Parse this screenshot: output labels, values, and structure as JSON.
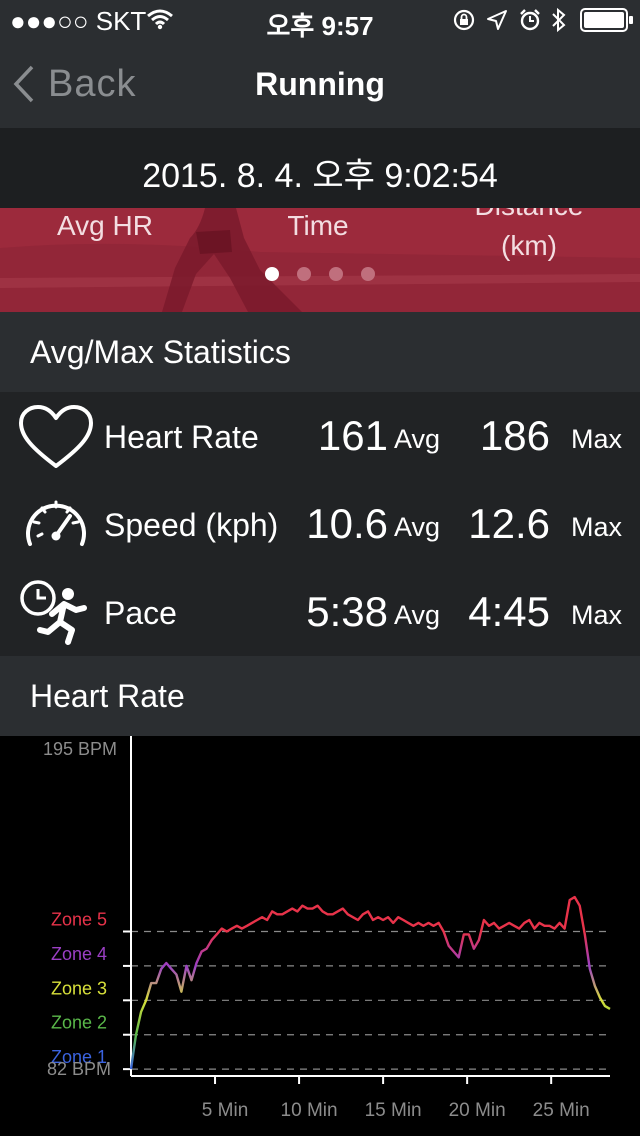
{
  "status_bar": {
    "carrier": "●●●○○ SKT",
    "time": "오후 9:57"
  },
  "nav": {
    "back_label": "Back",
    "title": "Running"
  },
  "date_label": "2015. 8. 4. 오후 9:02:54",
  "banner": {
    "labels": [
      "Avg HR",
      "Time",
      "Distance",
      "(km)"
    ],
    "page_count": 4,
    "active_page": 0
  },
  "avgmax": {
    "header": "Avg/Max Statistics",
    "rows": [
      {
        "label": "Heart Rate",
        "avg": "161",
        "avg_unit": "Avg",
        "max": "186",
        "max_unit": "Max",
        "icon": "heart-icon"
      },
      {
        "label": "Speed (kph)",
        "avg": "10.6",
        "avg_unit": "Avg",
        "max": "12.6",
        "max_unit": "Max",
        "icon": "speedometer-icon"
      },
      {
        "label": "Pace",
        "avg": "5:38",
        "avg_unit": "Avg",
        "max": "4:45",
        "max_unit": "Max",
        "icon": "runner-clock-icon"
      }
    ]
  },
  "heart_rate_header": "Heart Rate",
  "chart_data": {
    "type": "line",
    "xlabel": "",
    "ylabel": "",
    "x_unit": "min",
    "xlim": [
      0,
      28.5
    ],
    "ylim": [
      82,
      195
    ],
    "x_ticks": [
      5,
      10,
      15,
      20,
      25
    ],
    "x_tick_labels": [
      "5 Min",
      "10 Min",
      "15 Min",
      "20 Min",
      "25 Min"
    ],
    "y_top_label": "195 BPM",
    "y_bottom_label": "82 BPM",
    "zones": [
      {
        "name": "Zone 1",
        "value": 83,
        "color": "#3b63e0"
      },
      {
        "name": "Zone 2",
        "value": 95,
        "color": "#5ab84a"
      },
      {
        "name": "Zone 3",
        "value": 107,
        "color": "#d8e03a"
      },
      {
        "name": "Zone 4",
        "value": 119,
        "color": "#9b3fc4"
      },
      {
        "name": "Zone 5",
        "value": 131,
        "color": "#e8334a"
      }
    ],
    "grid": true,
    "series": [
      {
        "x": [
          0,
          0.3,
          0.6,
          0.9,
          1.2,
          1.5,
          1.8,
          2.1,
          2.4,
          2.7,
          3.0,
          3.3,
          3.6,
          3.9,
          4.2,
          4.5,
          4.8,
          5.1,
          5.4,
          5.7,
          6.0,
          6.3,
          6.6,
          6.9,
          7.2,
          7.5,
          7.8,
          8.1,
          8.4,
          8.7,
          9.0,
          9.3,
          9.6,
          9.9,
          10.2,
          10.5,
          10.8,
          11.1,
          11.4,
          11.7,
          12.0,
          12.3,
          12.6,
          12.9,
          13.2,
          13.5,
          13.8,
          14.1,
          14.4,
          14.7,
          15.0,
          15.3,
          15.6,
          15.9,
          16.2,
          16.5,
          16.8,
          17.1,
          17.4,
          17.7,
          18.0,
          18.3,
          18.6,
          18.9,
          19.2,
          19.5,
          19.8,
          20.1,
          20.4,
          20.7,
          21.0,
          21.3,
          21.6,
          21.9,
          22.2,
          22.5,
          22.8,
          23.1,
          23.4,
          23.7,
          24.0,
          24.3,
          24.6,
          24.9,
          25.2,
          25.5,
          25.8,
          26.1,
          26.4,
          26.7,
          27.0,
          27.3,
          27.6,
          27.9,
          28.2,
          28.5
        ],
        "y": [
          83,
          95,
          103,
          107,
          113,
          113,
          118,
          120,
          118,
          116,
          110,
          119,
          114,
          120,
          124,
          125,
          128,
          130,
          132,
          131,
          132,
          133,
          132,
          133,
          134,
          135,
          136,
          135,
          138,
          137,
          137,
          138,
          139,
          138,
          140,
          139,
          139,
          140,
          138,
          137,
          137,
          138,
          139,
          137,
          136,
          135,
          137,
          138,
          135,
          136,
          135,
          136,
          134,
          136,
          135,
          134,
          133,
          134,
          133,
          134,
          133,
          134,
          131,
          126,
          124,
          122,
          130,
          130,
          125,
          128,
          135,
          133,
          134,
          132,
          133,
          134,
          133,
          132,
          134,
          135,
          132,
          134,
          133,
          133,
          132,
          134,
          132,
          142,
          143,
          140,
          130,
          118,
          112,
          108,
          105,
          104
        ]
      }
    ]
  }
}
